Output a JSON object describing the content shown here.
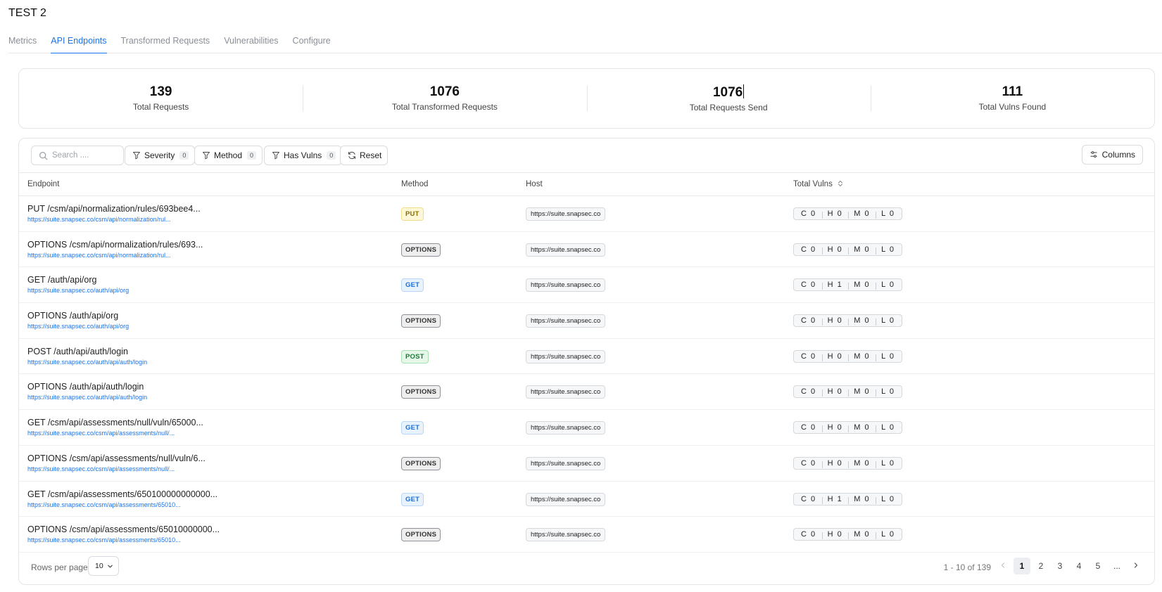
{
  "page": {
    "title": "TEST 2"
  },
  "tabs": [
    {
      "label": "Metrics",
      "active": false
    },
    {
      "label": "API Endpoints",
      "active": true
    },
    {
      "label": "Transformed Requests",
      "active": false
    },
    {
      "label": "Vulnerabilities",
      "active": false
    },
    {
      "label": "Configure",
      "active": false
    }
  ],
  "stats": [
    {
      "value": "139",
      "label": "Total Requests"
    },
    {
      "value": "1076",
      "label": "Total Transformed Requests"
    },
    {
      "value": "1076",
      "label": "Total Requests Send"
    },
    {
      "value": "111",
      "label": "Total Vulns Found"
    }
  ],
  "toolbar": {
    "search_placeholder": "Search ....",
    "filters": [
      {
        "label": "Severity",
        "count": "0"
      },
      {
        "label": "Method",
        "count": "0"
      },
      {
        "label": "Has Vulns",
        "count": "0"
      }
    ],
    "reset_label": "Reset",
    "columns_label": "Columns"
  },
  "table": {
    "headers": {
      "endpoint": "Endpoint",
      "method": "Method",
      "host": "Host",
      "vulns": "Total Vulns"
    },
    "rows": [
      {
        "path": "PUT /csm/api/normalization/rules/693bee4...",
        "url": "https://suite.snapsec.co/csm/api/normalization/rul...",
        "method": "PUT",
        "host": "https://suite.snapsec.co",
        "c": "C 0",
        "h": "H 0",
        "m": "M 0",
        "l": "L 0"
      },
      {
        "path": "OPTIONS /csm/api/normalization/rules/693...",
        "url": "https://suite.snapsec.co/csm/api/normalization/rul...",
        "method": "OPTIONS",
        "host": "https://suite.snapsec.co",
        "c": "C 0",
        "h": "H 0",
        "m": "M 0",
        "l": "L 0"
      },
      {
        "path": "GET /auth/api/org",
        "url": "https://suite.snapsec.co/auth/api/org",
        "method": "GET",
        "host": "https://suite.snapsec.co",
        "c": "C 0",
        "h": "H 1",
        "m": "M 0",
        "l": "L 0"
      },
      {
        "path": "OPTIONS /auth/api/org",
        "url": "https://suite.snapsec.co/auth/api/org",
        "method": "OPTIONS",
        "host": "https://suite.snapsec.co",
        "c": "C 0",
        "h": "H 0",
        "m": "M 0",
        "l": "L 0"
      },
      {
        "path": "POST /auth/api/auth/login",
        "url": "https://suite.snapsec.co/auth/api/auth/login",
        "method": "POST",
        "host": "https://suite.snapsec.co",
        "c": "C 0",
        "h": "H 0",
        "m": "M 0",
        "l": "L 0"
      },
      {
        "path": "OPTIONS /auth/api/auth/login",
        "url": "https://suite.snapsec.co/auth/api/auth/login",
        "method": "OPTIONS",
        "host": "https://suite.snapsec.co",
        "c": "C 0",
        "h": "H 0",
        "m": "M 0",
        "l": "L 0"
      },
      {
        "path": "GET /csm/api/assessments/null/vuln/65000...",
        "url": "https://suite.snapsec.co/csm/api/assessments/null/...",
        "method": "GET",
        "host": "https://suite.snapsec.co",
        "c": "C 0",
        "h": "H 0",
        "m": "M 0",
        "l": "L 0"
      },
      {
        "path": "OPTIONS /csm/api/assessments/null/vuln/6...",
        "url": "https://suite.snapsec.co/csm/api/assessments/null/...",
        "method": "OPTIONS",
        "host": "https://suite.snapsec.co",
        "c": "C 0",
        "h": "H 0",
        "m": "M 0",
        "l": "L 0"
      },
      {
        "path": "GET /csm/api/assessments/650100000000000...",
        "url": "https://suite.snapsec.co/csm/api/assessments/65010...",
        "method": "GET",
        "host": "https://suite.snapsec.co",
        "c": "C 0",
        "h": "H 1",
        "m": "M 0",
        "l": "L 0"
      },
      {
        "path": "OPTIONS /csm/api/assessments/65010000000...",
        "url": "https://suite.snapsec.co/csm/api/assessments/65010...",
        "method": "OPTIONS",
        "host": "https://suite.snapsec.co",
        "c": "C 0",
        "h": "H 0",
        "m": "M 0",
        "l": "L 0"
      }
    ]
  },
  "footer": {
    "rows_per_page_label": "Rows per page",
    "rows_per_page_value": "10",
    "range_text": "1 - 10 of 139",
    "pages": [
      "1",
      "2",
      "3",
      "4",
      "5",
      "..."
    ],
    "current_page": "1"
  },
  "colors": {
    "accent": "#1a73e8"
  },
  "icons": {
    "search": "search-icon",
    "filter": "filter-icon",
    "reset": "refresh-icon",
    "columns": "columns-icon",
    "sort": "sort-icon",
    "chevron": "chevron-down-icon",
    "prev": "chevron-left-icon",
    "next": "chevron-right-icon"
  }
}
